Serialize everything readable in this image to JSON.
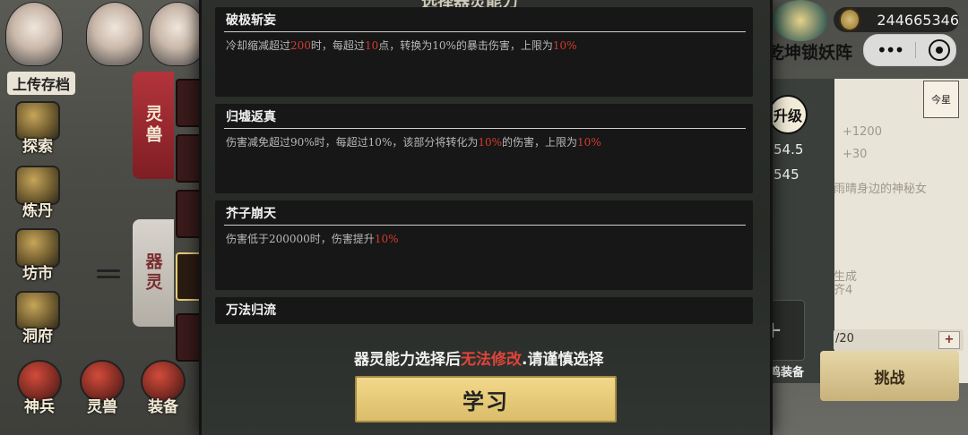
{
  "top_bar": {
    "currency_value": "244665346",
    "game_title": "乾坤锁妖阵",
    "menu_dots": "•••"
  },
  "left_nav": {
    "label_top": "上传存档",
    "items": [
      {
        "label": "探索",
        "icon": "explore-icon"
      },
      {
        "label": "炼丹",
        "icon": "alchemy-icon"
      },
      {
        "label": "坊市",
        "icon": "market-icon"
      },
      {
        "label": "洞府",
        "icon": "cave-icon"
      }
    ],
    "bottom_items": [
      {
        "label": "神兵",
        "icon": "weapon-icon"
      },
      {
        "label": "灵兽",
        "icon": "beast-icon"
      },
      {
        "label": "装备",
        "icon": "equipment-icon"
      }
    ],
    "tab_beast": "灵兽",
    "tab_spirit": "器灵"
  },
  "right_panel": {
    "upgrade_label": "升级",
    "stat_1": "54.5",
    "stat_2": "545",
    "ghost_1": "+1200",
    "ghost_2": "+30",
    "ghost_3": "雨晴身边的神秘女",
    "ghost_4": "生成",
    "ghost_5": "齐4",
    "equip_label": "共鸣装备",
    "plus_symbol": "+",
    "count_text": "/20",
    "count_plus": "+",
    "challenge_label": "挑战",
    "seal_text": "今星"
  },
  "modal": {
    "title": "选择器灵能力",
    "abilities": [
      {
        "name": "破极斩妄",
        "desc_parts": [
          "冷却缩减超过",
          "200",
          "时，每超过",
          "10",
          "点，转换为10%的暴击伤害，上限为",
          "10%"
        ]
      },
      {
        "name": "归墟返真",
        "desc_parts": [
          "伤害减免超过90%时，每超过10%，该部分将转化为",
          "10%",
          "的伤害，上限为",
          "10%"
        ]
      },
      {
        "name": "芥子崩天",
        "desc_parts": [
          "伤害低于200000时，伤害提升",
          "10%"
        ]
      },
      {
        "name": "万法归流",
        "desc_parts": []
      }
    ],
    "notice_prefix": "器灵能力选择后",
    "notice_warn": "无法修改",
    "notice_suffix": ".请谨慎选择",
    "learn_button": "学习"
  },
  "colors": {
    "highlight": "#d43a32",
    "button_gold": "#e6c97a",
    "tab_red": "#b3343b"
  }
}
